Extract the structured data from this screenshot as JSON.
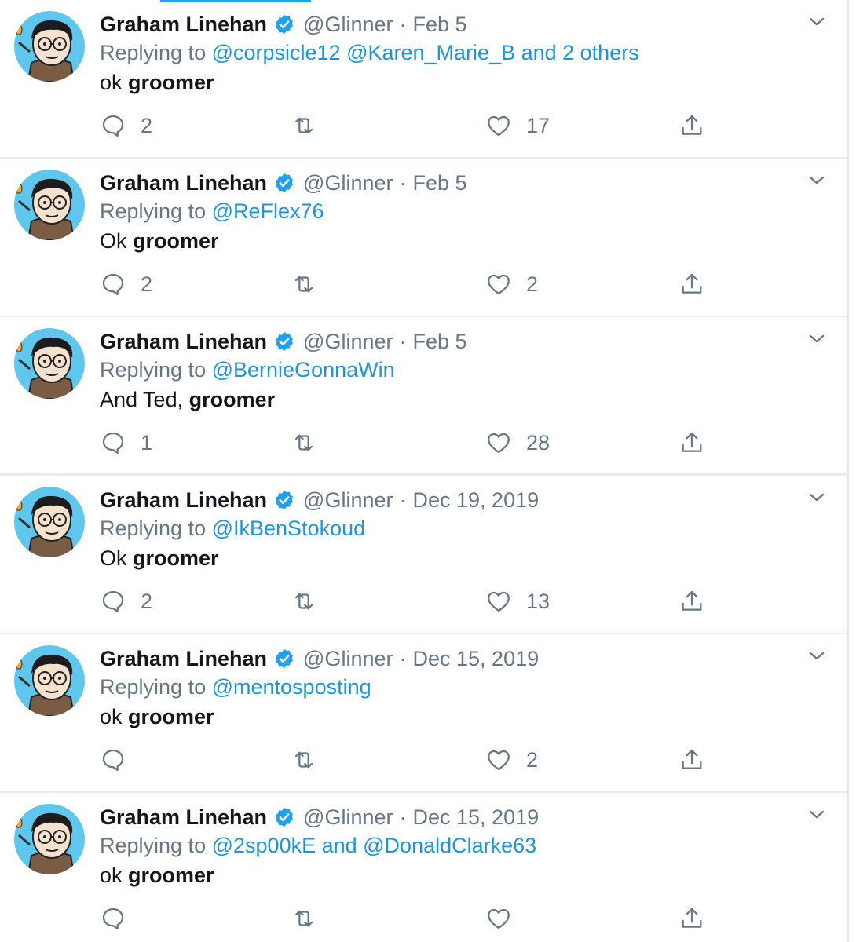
{
  "tweets": [
    {
      "name": "Graham Linehan",
      "handle": "@Glinner",
      "separator": "·",
      "date": "Feb 5",
      "reply_prefix": "Replying to",
      "reply_to": "@corpsicle12 @Karen_Marie_B and 2 others",
      "text_plain": "ok ",
      "text_bold": "groomer",
      "reply_count": "2",
      "retweet_count": "",
      "like_count": "17"
    },
    {
      "name": "Graham Linehan",
      "handle": "@Glinner",
      "separator": "·",
      "date": "Feb 5",
      "reply_prefix": "Replying to",
      "reply_to": "@ReFlex76",
      "text_plain": "Ok ",
      "text_bold": "groomer",
      "reply_count": "2",
      "retweet_count": "",
      "like_count": "2"
    },
    {
      "name": "Graham Linehan",
      "handle": "@Glinner",
      "separator": "·",
      "date": "Feb 5",
      "reply_prefix": "Replying to",
      "reply_to": "@BernieGonnaWin",
      "text_plain": "And Ted, ",
      "text_bold": "groomer",
      "reply_count": "1",
      "retweet_count": "",
      "like_count": "28"
    },
    {
      "name": "Graham Linehan",
      "handle": "@Glinner",
      "separator": "·",
      "date": "Dec 19, 2019",
      "reply_prefix": "Replying to",
      "reply_to": "@IkBenStokoud",
      "text_plain": "Ok ",
      "text_bold": "groomer",
      "reply_count": "2",
      "retweet_count": "",
      "like_count": "13"
    },
    {
      "name": "Graham Linehan",
      "handle": "@Glinner",
      "separator": "·",
      "date": "Dec 15, 2019",
      "reply_prefix": "Replying to",
      "reply_to": "@mentosposting",
      "text_plain": "ok ",
      "text_bold": "groomer",
      "reply_count": "",
      "retweet_count": "",
      "like_count": "2"
    },
    {
      "name": "Graham Linehan",
      "handle": "@Glinner",
      "separator": "·",
      "date": "Dec 15, 2019",
      "reply_prefix": "Replying to",
      "reply_to": "@2sp00kE and @DonaldClarke63",
      "text_plain": "ok ",
      "text_bold": "groomer",
      "reply_count": "",
      "retweet_count": "",
      "like_count": ""
    }
  ],
  "icons": {
    "verified": "verified-badge-icon",
    "caret": "chevron-down-icon",
    "reply": "reply-bubble-icon",
    "retweet": "retweet-icon",
    "like": "heart-icon",
    "share": "share-icon"
  },
  "colors": {
    "text": "#14171a",
    "secondary": "#657786",
    "link": "#1b95e0",
    "verified": "#1da1f2",
    "divider": "#e6ecf0",
    "avatar_bg": "#5fc6ee"
  }
}
